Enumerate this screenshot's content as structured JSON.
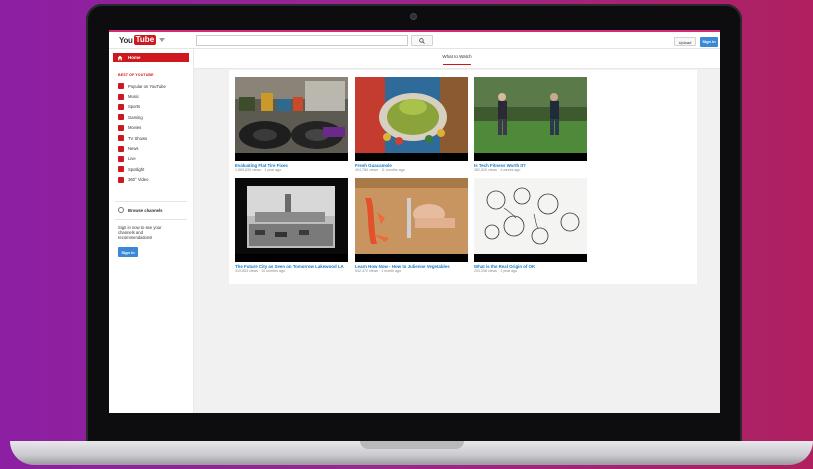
{
  "header": {
    "logo_you": "You",
    "logo_tube": "Tube",
    "search_placeholder": "",
    "upload_label": "Upload",
    "signin_label": "Sign in"
  },
  "sidebar": {
    "home_label": "Home",
    "section_title": "Best of YouTube",
    "items": [
      {
        "label": "Popular on YouTube"
      },
      {
        "label": "Music"
      },
      {
        "label": "Sports"
      },
      {
        "label": "Gaming"
      },
      {
        "label": "Movies"
      },
      {
        "label": "TV Shows"
      },
      {
        "label": "News"
      },
      {
        "label": "Live"
      },
      {
        "label": "Spotlight"
      },
      {
        "label": "360° Video"
      }
    ],
    "browse_label": "Browse channels",
    "signin_prompt": "Sign in now to see your channels and recommendations!",
    "signin_button": "Sign in"
  },
  "tabs": {
    "active": "What to Watch"
  },
  "videos": [
    {
      "title": "Evaluating Flat Tire Fixes",
      "views": "1,889,835 views",
      "age": "1 year ago"
    },
    {
      "title": "Fresh Guacamole",
      "views": "404,789 views",
      "age": "11 months ago"
    },
    {
      "title": "Is Tech Fitness Worth It?",
      "views": "382,529 views",
      "age": "4 weeks ago"
    },
    {
      "title": "The Future City as Seen on Tomorrow Lakewood LA",
      "views": "319,653 views",
      "age": "10 months ago"
    },
    {
      "title": "Learn How Now - How to Julienne Vegetables",
      "views": "542,472 views",
      "age": "1 month ago"
    },
    {
      "title": "What is the Real Origin of OK",
      "views": "203,298 views",
      "age": "1 year ago"
    }
  ],
  "colors": {
    "brand_red": "#cc181e",
    "link_blue": "#167ac6",
    "signin_blue": "#3a88d8"
  }
}
